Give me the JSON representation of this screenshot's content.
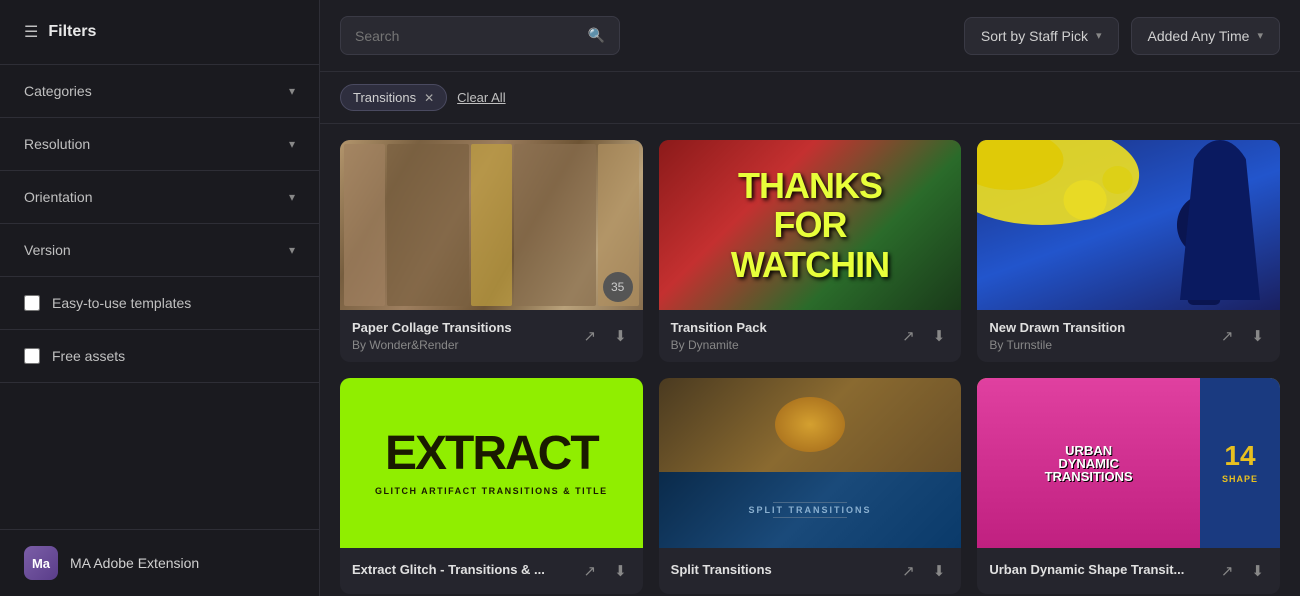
{
  "sidebar": {
    "filters_label": "Filters",
    "sections": [
      {
        "label": "Categories"
      },
      {
        "label": "Resolution"
      },
      {
        "label": "Orientation"
      },
      {
        "label": "Version"
      }
    ],
    "checkboxes": [
      {
        "label": "Easy-to-use templates",
        "checked": false
      },
      {
        "label": "Free assets",
        "checked": false
      }
    ],
    "user": {
      "initials": "Ma",
      "name": "MA Adobe Extension"
    }
  },
  "topbar": {
    "search_placeholder": "Search",
    "sort_label": "Sort by Staff Pick",
    "added_label": "Added Any Time"
  },
  "filter_tags": {
    "active": [
      {
        "label": "Transitions"
      }
    ],
    "clear_all": "Clear All"
  },
  "grid": {
    "cards": [
      {
        "id": "paper-collage",
        "title": "Paper Collage Transitions",
        "author": "By Wonder&Render",
        "thumb_type": "paper-collage"
      },
      {
        "id": "transition-pack",
        "title": "Transition Pack",
        "author": "By Dynamite",
        "thumb_type": "transition-pack",
        "thumb_text": "THANKS\nFOR\nWATCHIN"
      },
      {
        "id": "new-drawn",
        "title": "New Drawn Transition",
        "author": "By Turnstile",
        "thumb_type": "new-drawn"
      },
      {
        "id": "extract-glitch",
        "title": "Extract Glitch - Transitions & ...",
        "author": "",
        "thumb_type": "extract",
        "thumb_big": "EXTRACT",
        "thumb_small": "GLITCH ARTIFACT TRANSITIONS & TITLE"
      },
      {
        "id": "split-transitions",
        "title": "Split Transitions",
        "author": "",
        "thumb_type": "split",
        "split_label": "SPLIT TRANSITIONS"
      },
      {
        "id": "urban-dynamic",
        "title": "Urban Dynamic Shape Transit...",
        "author": "",
        "thumb_type": "urban"
      }
    ]
  }
}
